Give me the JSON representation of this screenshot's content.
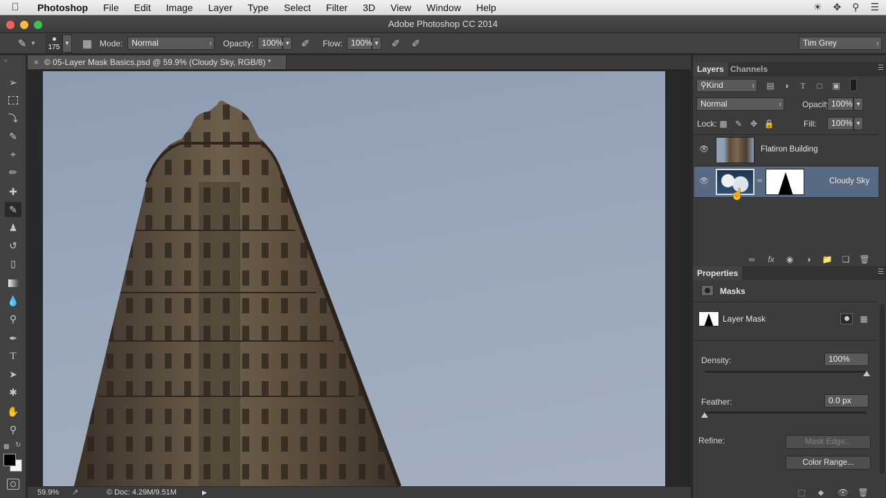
{
  "menubar": {
    "app": "Photoshop",
    "items": [
      "File",
      "Edit",
      "Image",
      "Layer",
      "Type",
      "Select",
      "Filter",
      "3D",
      "View",
      "Window",
      "Help"
    ],
    "icons": [
      "sun-icon",
      "move-icon",
      "search-icon",
      "list-icon"
    ]
  },
  "window": {
    "title": "Adobe Photoshop CC 2014"
  },
  "options": {
    "brush_size": "175",
    "mode_label": "Mode:",
    "mode_value": "Normal",
    "opacity_label": "Opacity:",
    "opacity_value": "100%",
    "flow_label": "Flow:",
    "flow_value": "100%",
    "workspace": "Tim Grey"
  },
  "document": {
    "tab_title": "© 05-Layer Mask Basics.psd @ 59.9% (Cloudy Sky, RGB/8) *",
    "zoom": "59.9%",
    "doc_info": "© Doc: 4.29M/9.51M"
  },
  "layers_panel": {
    "tabs": [
      "Layers",
      "Channels"
    ],
    "filter_value": "Kind",
    "blend_mode": "Normal",
    "opacity_label": "Opacity:",
    "opacity_value": "100%",
    "lock_label": "Lock:",
    "fill_label": "Fill:",
    "fill_value": "100%",
    "layers": [
      {
        "name": "Flatiron Building",
        "selected": false
      },
      {
        "name": "Cloudy Sky",
        "selected": true
      }
    ]
  },
  "properties_panel": {
    "title": "Properties",
    "section": "Masks",
    "mask_label": "Layer Mask",
    "density_label": "Density:",
    "density_value": "100%",
    "density_level": 1.0,
    "feather_label": "Feather:",
    "feather_value": "0.0 px",
    "feather_level": 0.0,
    "refine_label": "Refine:",
    "mask_edge_button": "Mask Edge...",
    "color_range_button": "Color Range..."
  },
  "colors": {
    "selection": "#586a83",
    "panel_bg": "#3c3c3c"
  }
}
